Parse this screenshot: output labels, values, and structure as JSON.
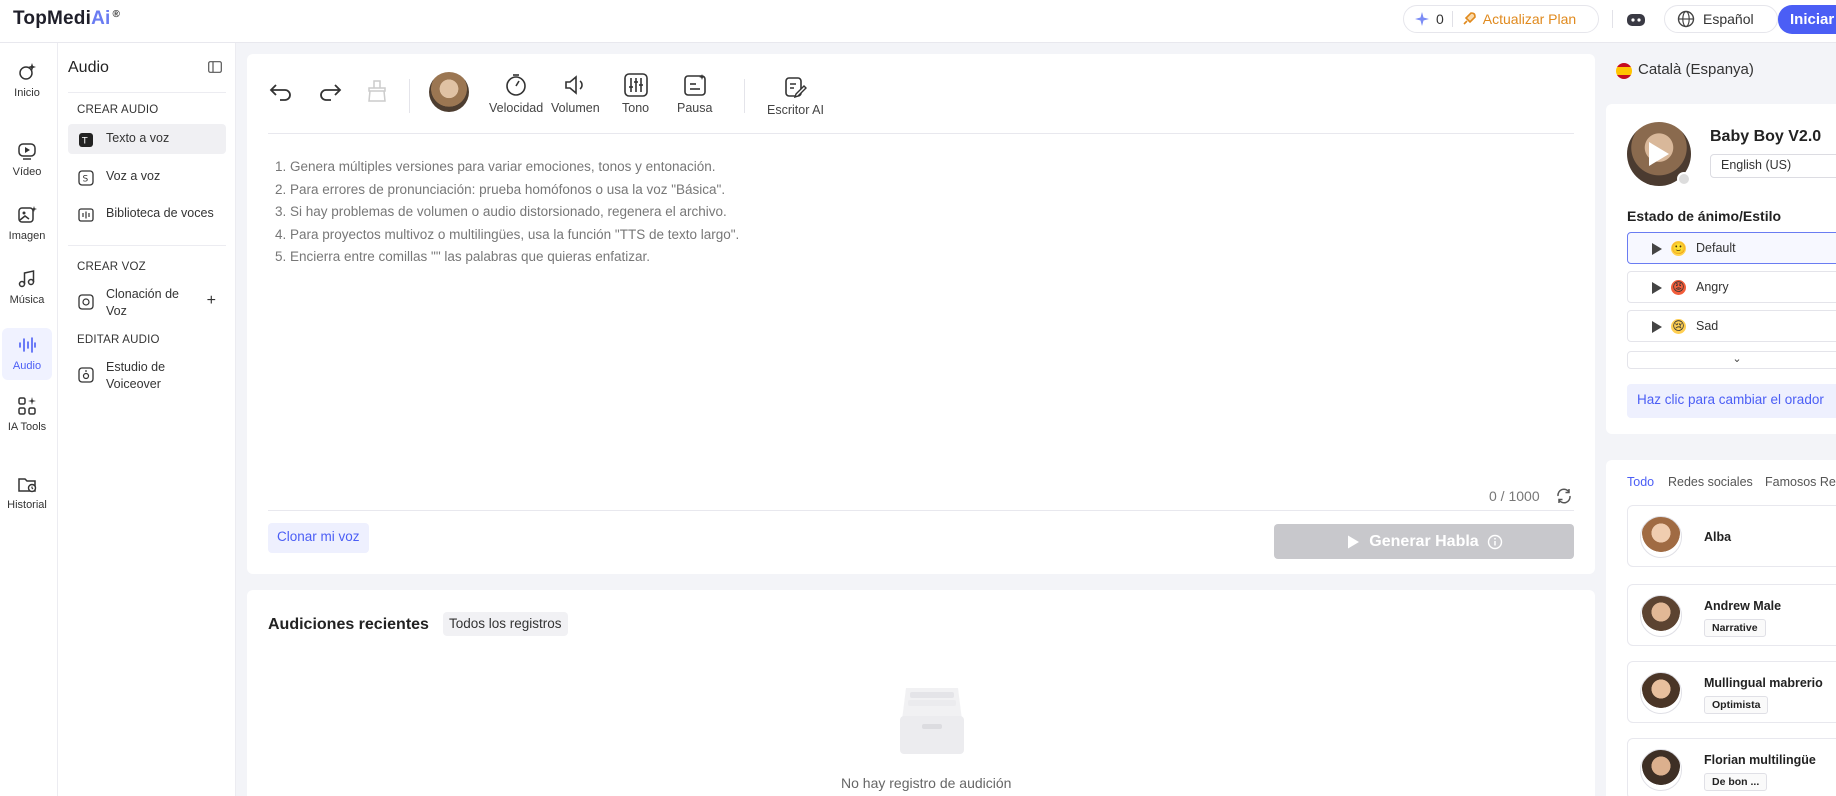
{
  "app": {
    "logo_main": "TopMedi",
    "logo_ai": "Ai",
    "logo_reg": "®"
  },
  "topbar": {
    "credits": "0",
    "upgrade_label": "Actualizar Plan",
    "language_label": "Español",
    "start_label": "Iniciar"
  },
  "rail": {
    "items": [
      {
        "label": "Inicio",
        "icon": "home-spark-icon"
      },
      {
        "label": "Vídeo",
        "icon": "video-icon"
      },
      {
        "label": "Imagen",
        "icon": "image-icon"
      },
      {
        "label": "Música",
        "icon": "music-icon"
      },
      {
        "label": "Audio",
        "icon": "audio-wave-icon"
      },
      {
        "label": "IA Tools",
        "icon": "grid-icon"
      },
      {
        "label": "Historial",
        "icon": "history-icon"
      }
    ]
  },
  "sidebar": {
    "title": "Audio",
    "section_create_audio": "CREAR AUDIO",
    "text_to_speech": "Texto a voz",
    "voice_to_voice": "Voz a voz",
    "voice_library": "Biblioteca de voces",
    "section_create_voice": "CREAR VOZ",
    "voice_cloning": "Clonación de Voz",
    "section_edit_audio": "EDITAR AUDIO",
    "voiceover_studio": "Estudio de Voiceover"
  },
  "toolbar": {
    "speed": "Velocidad",
    "volume": "Volumen",
    "tone": "Tono",
    "pause": "Pausa",
    "ai_writer": "Escritor AI"
  },
  "editor": {
    "tips": [
      "1. Genera múltiples versiones para variar emociones, tonos y entonación.",
      "2. Para errores de pronunciación: prueba homófonos o usa la voz \"Básica\".",
      "3. Si hay problemas de volumen o audio distorsionado, regenera el archivo.",
      "4. Para proyectos multivoz o multilingües, usa la función \"TTS de texto largo\".",
      "5. Encierra entre comillas \"\" las palabras que quieras enfatizar."
    ],
    "counter": "0 / 1000",
    "clone_label": "Clonar mi voz",
    "generate_label": "Generar Habla"
  },
  "recent": {
    "title": "Audiciones recientes",
    "tab_all": "Todos los registros",
    "empty": "No hay registro de audición"
  },
  "right": {
    "language": "Català (Espanya)",
    "voice_name": "Baby Boy V2.0",
    "voice_lang": "English (US)",
    "mood_title": "Estado de ánimo/Estilo",
    "moods": [
      {
        "label": "Default",
        "emoji": "🙂"
      },
      {
        "label": "Angry",
        "emoji": "😡"
      },
      {
        "label": "Sad",
        "emoji": "😢"
      }
    ],
    "change_speaker": "Haz clic para cambiar el orador",
    "tabs": [
      "Todo",
      "Redes sociales",
      "Famosos Re"
    ],
    "voices": [
      {
        "name": "Alba",
        "tag": ""
      },
      {
        "name": "Andrew Male",
        "tag": "Narrative"
      },
      {
        "name": "Mullingual mabrerio",
        "tag": "Optimista"
      },
      {
        "name": "Florian multilingüe",
        "tag": "De bon ..."
      }
    ]
  },
  "colors": {
    "accent": "#4b5ef5",
    "upgrade": "#e08a1e",
    "disabled": "#c8c8cc"
  }
}
